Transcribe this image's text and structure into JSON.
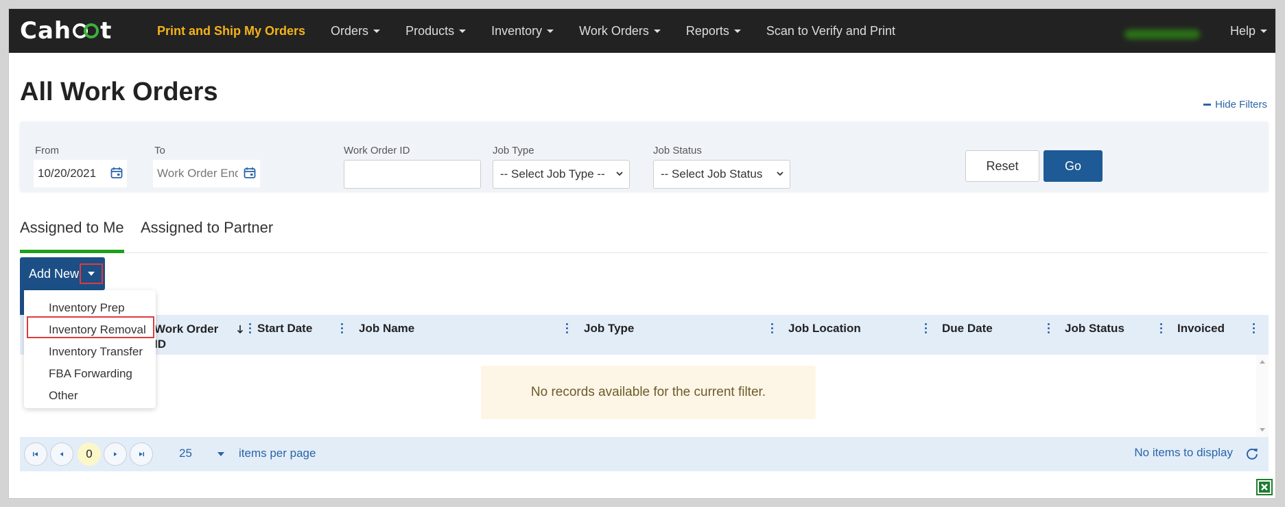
{
  "navbar": {
    "logo_text": "Cahoot",
    "items": [
      {
        "label": "Print and Ship My Orders",
        "highlight": true,
        "has_caret": false
      },
      {
        "label": "Orders",
        "has_caret": true
      },
      {
        "label": "Products",
        "has_caret": true
      },
      {
        "label": "Inventory",
        "has_caret": true
      },
      {
        "label": "Work Orders",
        "has_caret": true
      },
      {
        "label": "Reports",
        "has_caret": true
      },
      {
        "label": "Scan to Verify and Print",
        "has_caret": false
      }
    ],
    "help_label": "Help",
    "accent_color": "#f5b318"
  },
  "page": {
    "title": "All Work Orders",
    "hide_filters_label": "Hide Filters"
  },
  "filters": {
    "from_label": "From",
    "from_value": "10/20/2021",
    "to_label": "To",
    "to_placeholder": "Work Order End",
    "work_order_id_label": "Work Order ID",
    "work_order_id_value": "",
    "job_type_label": "Job Type",
    "job_type_selected": "-- Select Job Type --",
    "job_status_label": "Job Status",
    "job_status_selected": "-- Select Job Status",
    "reset_label": "Reset",
    "go_label": "Go"
  },
  "tabs": [
    {
      "label": "Assigned to Me",
      "active": true
    },
    {
      "label": "Assigned to Partner",
      "active": false
    }
  ],
  "add_new": {
    "label": "Add New",
    "menu_items": [
      "Inventory Prep",
      "Inventory Removal",
      "Inventory Transfer",
      "FBA Forwarding",
      "Other"
    ],
    "highlighted_item": "Inventory Removal"
  },
  "grid": {
    "columns": [
      "Work Order ID",
      "Start Date",
      "Job Name",
      "Job Type",
      "Job Location",
      "Due Date",
      "Job Status",
      "Invoiced"
    ],
    "sorted_column": "Work Order ID",
    "sort_direction": "descending",
    "empty_message": "No records available for the current filter."
  },
  "pager": {
    "current_page": "0",
    "page_size": "25",
    "per_page_label": "items per page",
    "status_text": "No items to display"
  },
  "colors": {
    "primary": "#1b4f86",
    "go_button": "#1e5a95",
    "active_tab": "#1fa01a",
    "header_bg": "#e3edf8",
    "highlight_box": "#e03a3a"
  }
}
